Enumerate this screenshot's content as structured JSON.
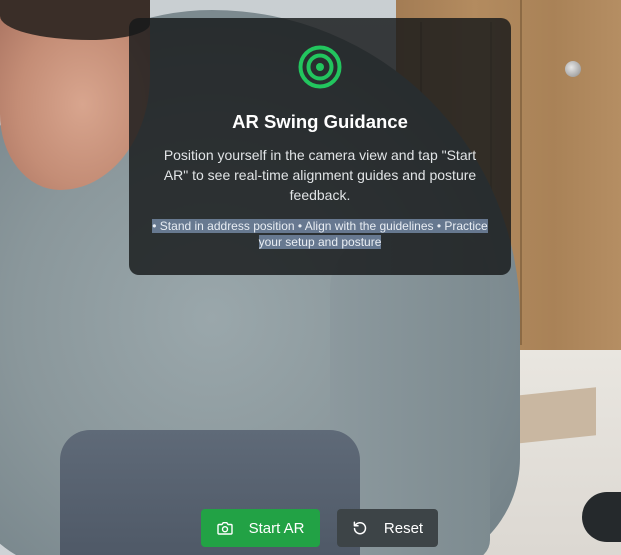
{
  "overlay": {
    "title": "AR Swing Guidance",
    "description": "Position yourself in the camera view and tap \"Start AR\" to see real-time alignment guides and posture feedback.",
    "tips": "• Stand in address position • Align with the guidelines • Practice your setup and posture",
    "icon": "target-icon",
    "accent_color": "#22c55e"
  },
  "controls": {
    "start": {
      "label": "Start AR",
      "icon": "camera-icon",
      "color": "#22a245"
    },
    "reset": {
      "label": "Reset",
      "icon": "reset-icon",
      "color": "#3d4447"
    }
  }
}
